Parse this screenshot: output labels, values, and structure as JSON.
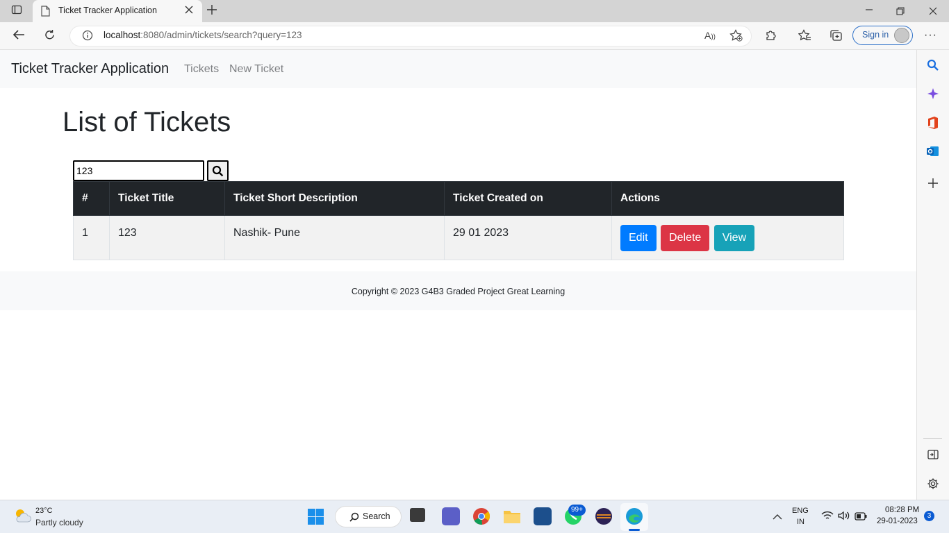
{
  "browser": {
    "tab_title": "Ticket Tracker Application",
    "url_host": "localhost",
    "url_rest": ":8080/admin/tickets/search?query=123",
    "signin_label": "Sign in"
  },
  "navbar": {
    "brand": "Ticket Tracker Application",
    "links": [
      "Tickets",
      "New Ticket"
    ]
  },
  "main": {
    "heading": "List of Tickets",
    "search_value": "123",
    "table": {
      "headers": [
        "#",
        "Ticket Title",
        "Ticket Short Description",
        "Ticket Created on",
        "Actions"
      ],
      "rows": [
        {
          "id": "1",
          "title": "123",
          "description": "Nashik- Pune",
          "created": "29 01 2023"
        }
      ],
      "actions": {
        "edit": "Edit",
        "delete": "Delete",
        "view": "View"
      }
    }
  },
  "footer": {
    "copyright": "Copyright © 2023 G4B3 Graded Project Great Learning"
  },
  "taskbar": {
    "weather_temp": "23°C",
    "weather_desc": "Partly cloudy",
    "search_label": "Search",
    "whatsapp_badge": "99+",
    "lang_line1": "ENG",
    "lang_line2": "IN",
    "time": "08:28 PM",
    "date": "29-01-2023",
    "notification_count": "3"
  },
  "colors": {
    "edit": "#007bff",
    "delete": "#dc3545",
    "view": "#17a2b8",
    "table_header": "#212529"
  },
  "icons": [
    "tab-actions-icon",
    "page-icon",
    "close-icon",
    "new-tab-icon",
    "back-icon",
    "refresh-icon",
    "info-icon",
    "read-aloud-icon",
    "add-favorite-icon",
    "extensions-icon",
    "favorites-icon",
    "collections-icon",
    "more-icon",
    "search-icon",
    "copilot-icon",
    "office-icon",
    "outlook-icon",
    "add-icon",
    "sidebar-toggle-icon",
    "settings-icon",
    "weather-icon",
    "windows-start-icon",
    "wifi-icon",
    "volume-icon",
    "battery-icon"
  ]
}
